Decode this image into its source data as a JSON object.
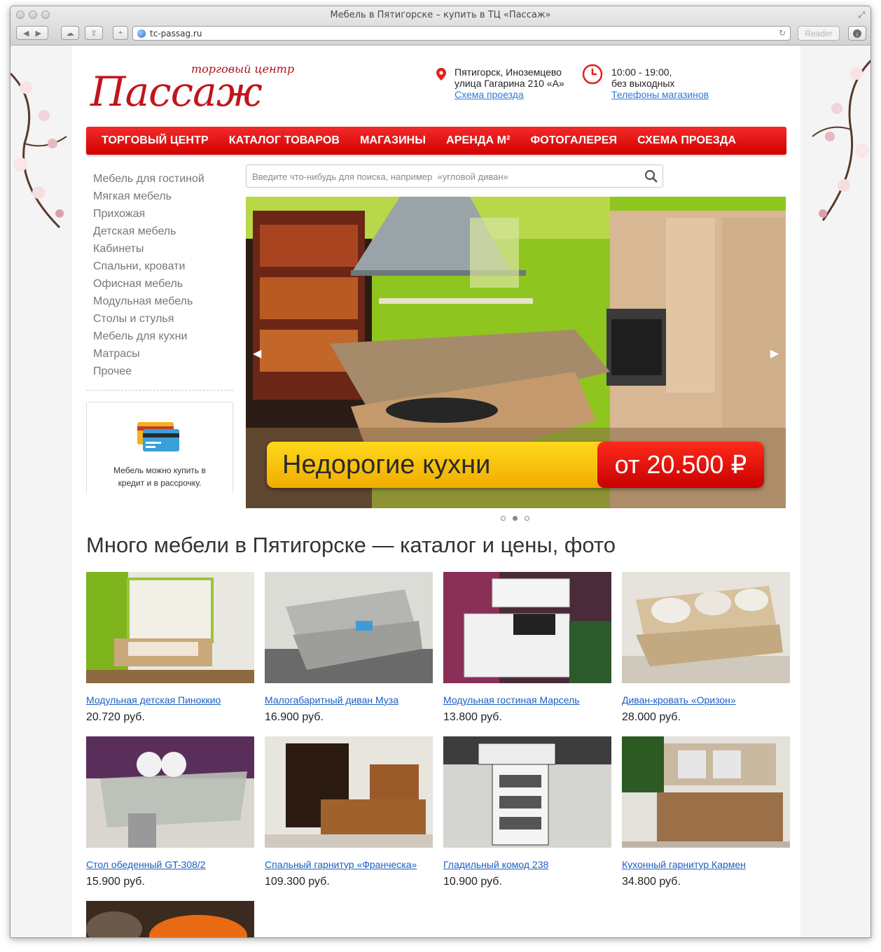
{
  "browser": {
    "window_title": "Мебель в Пятигорске – купить в ТЦ «Пассаж»",
    "url": "tc-passag.ru",
    "reader_label": "Reader"
  },
  "header": {
    "logo_sub": "торговый центр",
    "logo_main": "Пассаж",
    "address_line1": "Пятигорск, Иноземцево",
    "address_line2": "улица Гагарина 210 «А»",
    "address_link": "Схема проезда",
    "hours_line1": "10:00 - 19:00,",
    "hours_line2": "без выходных",
    "hours_link": "Телефоны магазинов"
  },
  "nav": [
    "ТОРГОВЫЙ ЦЕНТР",
    "КАТАЛОГ ТОВАРОВ",
    "МАГАЗИНЫ",
    "АРЕНДА М²",
    "ФОТОГАЛЕРЕЯ",
    "СХЕМА ПРОЕЗДА"
  ],
  "sidebar": {
    "items": [
      "Мебель для гостиной",
      "Мягкая мебель",
      "Прихожая",
      "Детская мебель",
      "Кабинеты",
      "Спальни, кровати",
      "Офисная мебель",
      "Модульная мебель",
      "Столы и стулья",
      "Мебель для кухни",
      "Матрасы",
      "Прочее"
    ],
    "credit_line1": "Мебель можно купить в",
    "credit_line2": "кредит и в рассрочку."
  },
  "search": {
    "placeholder": "Введите что-нибудь для поиска, например  «угловой диван»"
  },
  "slider": {
    "title": "Недорогие кухни",
    "price": "от 20.500 ₽",
    "slide_count": 3,
    "active_slide": 2
  },
  "heading": "Много мебели в Пятигорске — каталог и цены, фото",
  "products": [
    {
      "name": "Модульная детская Пинок­кио",
      "price": "20.720 руб."
    },
    {
      "name": "Малогабаритный диван Муза",
      "price": "16.900 руб."
    },
    {
      "name": "Модульная гостиная Марсель",
      "price": "13.800 руб."
    },
    {
      "name": "Диван-кровать «Оризон»",
      "price": "28.000 руб."
    },
    {
      "name": "Стол обеденный GT-308/2",
      "price": "15.900 руб."
    },
    {
      "name": "Спальный гарнитур «Франческа»",
      "price": "109.300 руб."
    },
    {
      "name": "Гладильный комод 238",
      "price": "10.900 руб."
    },
    {
      "name": "Кухонный гарнитур Кармен",
      "price": "34.800 руб."
    }
  ],
  "colors": {
    "brand_red": "#d30000",
    "link_blue": "#1a5fc5",
    "banner_yellow": "#ffd81c"
  }
}
